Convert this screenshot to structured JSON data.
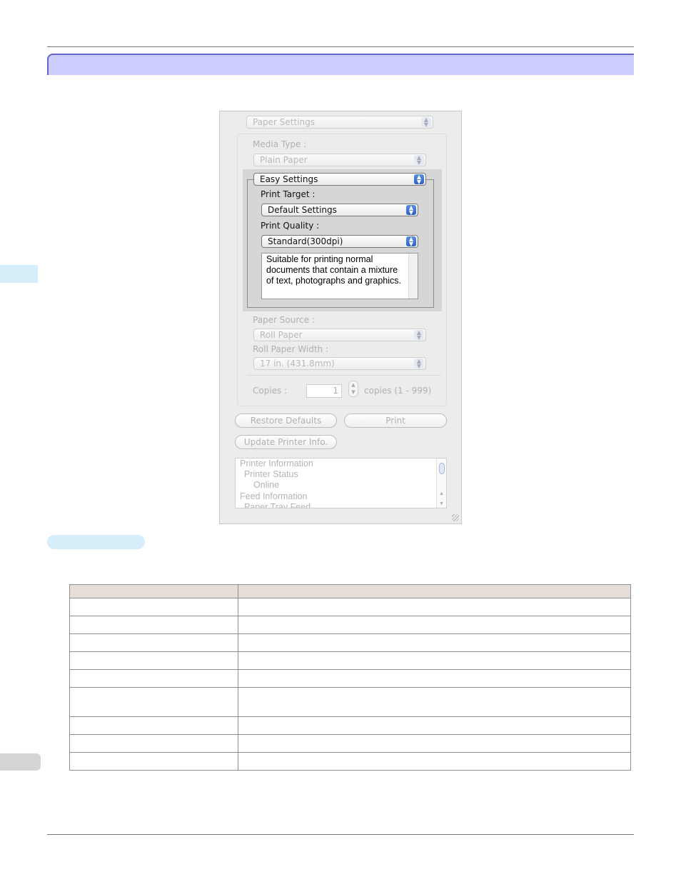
{
  "dialog": {
    "panel_selector": "Paper Settings",
    "media_type_label": "Media Type :",
    "media_type_value": "Plain Paper",
    "mode_selector": "Easy Settings",
    "print_target_label": "Print Target :",
    "print_target_value": "Default Settings",
    "print_quality_label": "Print Quality :",
    "print_quality_value": "Standard(300dpi)",
    "description": "Suitable for printing normal documents that contain a mixture of text, photographs and graphics.",
    "paper_source_label": "Paper Source :",
    "paper_source_value": "Roll Paper",
    "roll_width_label": "Roll Paper Width :",
    "roll_width_value": "17 in. (431.8mm)",
    "copies_label": "Copies :",
    "copies_value": "1",
    "copies_range": "copies (1 - 999)",
    "restore_button": "Restore Defaults",
    "print_button": "Print",
    "update_button": "Update Printer Info.",
    "info_lines": [
      "Printer Information",
      "Printer Status",
      "Online",
      "Feed Information",
      "Paper Tray Feed"
    ]
  },
  "table": {
    "header": [
      "",
      ""
    ],
    "rows": [
      [
        "",
        ""
      ],
      [
        "",
        ""
      ],
      [
        "",
        ""
      ],
      [
        "",
        ""
      ],
      [
        "",
        ""
      ],
      [
        "",
        ""
      ],
      [
        "",
        ""
      ],
      [
        "",
        ""
      ],
      [
        "",
        ""
      ]
    ]
  },
  "colors": {
    "section_bar": "#ccccff",
    "section_bar_border": "#6666cc",
    "side_tab": "#d6eefa",
    "table_header": "#e6ddd6"
  }
}
